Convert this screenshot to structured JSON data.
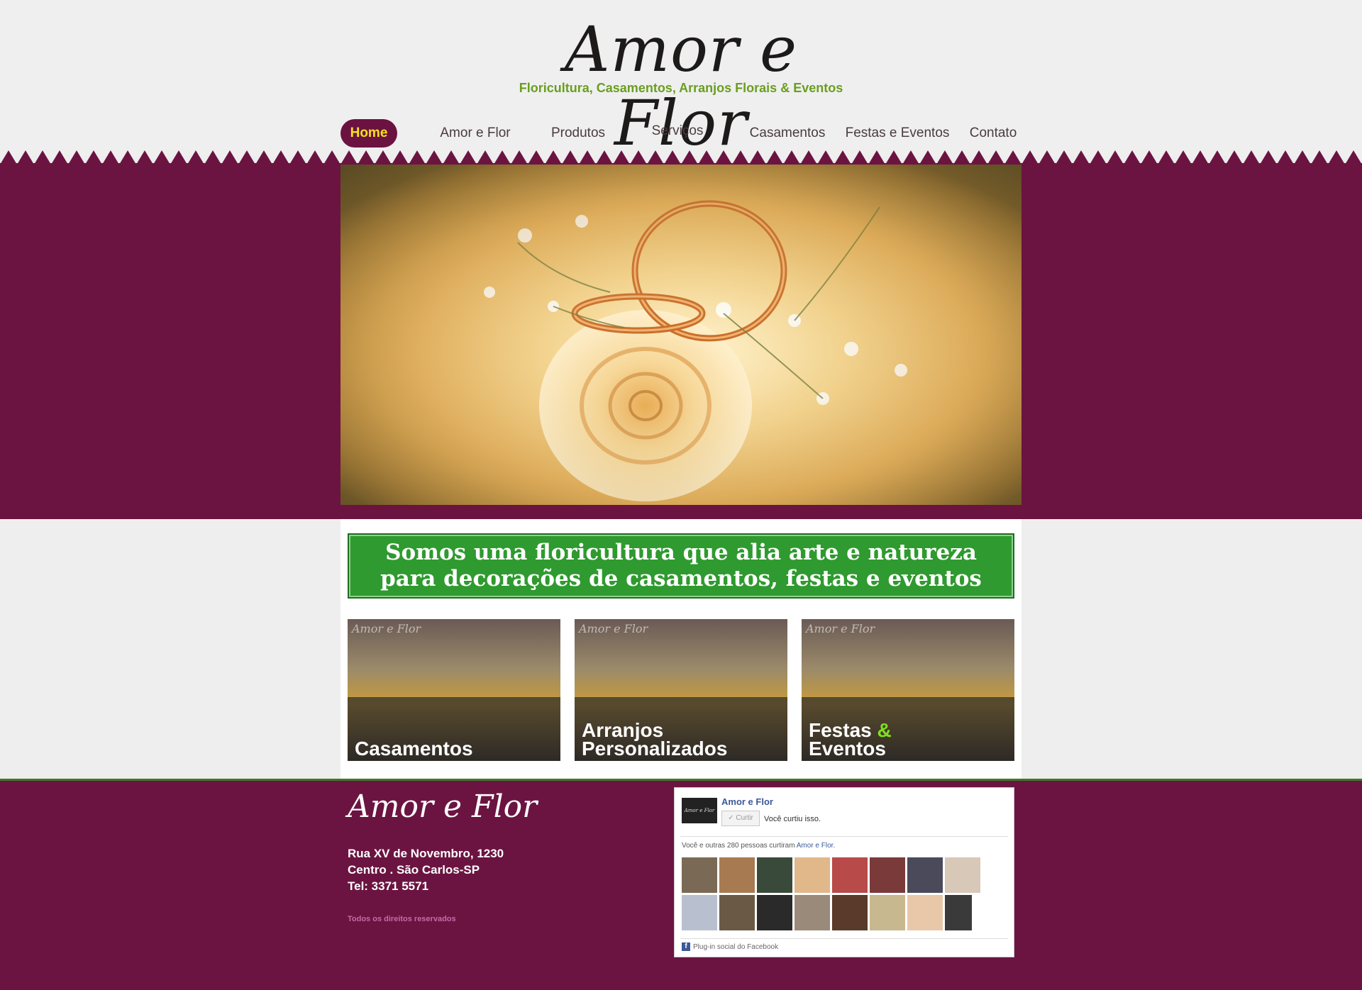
{
  "header": {
    "logo": "Amor e Flor",
    "tagline": "Floricultura, Casamentos, Arranjos Florais & Eventos"
  },
  "nav": [
    {
      "label": "Home",
      "active": true
    },
    {
      "label": "Amor e Flor"
    },
    {
      "label": "Produtos"
    },
    {
      "label": "Serviços"
    },
    {
      "label": "Casamentos"
    },
    {
      "label": "Festas e Eventos"
    },
    {
      "label": "Contato"
    }
  ],
  "banner": {
    "line1": "Somos uma floricultura que alia arte e natureza",
    "line2": "para decorações de casamentos, festas e eventos"
  },
  "cards": [
    {
      "line1": "Casamentos",
      "line2": ""
    },
    {
      "line1": "Arranjos",
      "line2": "Personalizados"
    },
    {
      "line1": "Festas",
      "amp": "&",
      "line2": "Eventos"
    }
  ],
  "card_watermark": "Amor e Flor",
  "footer": {
    "logo": "Amor e Flor",
    "address_line1": "Rua XV de Novembro, 1230",
    "address_line2": "Centro . São Carlos-SP",
    "phone": "Tel: 3371 5571",
    "rights": "Todos os direitos reservados"
  },
  "facebook": {
    "thumb_text": "Amor e Flor",
    "page_name": "Amor e Flor",
    "like_button": "✓ Curtir",
    "liked_text": "Você curtiu isso.",
    "count_text": "Você e outras 280 pessoas curtiram ",
    "count_link": "Amor e Flor.",
    "plugin_text": "Plug-in social do Facebook",
    "fb_icon": "f"
  },
  "colors": {
    "brand": "#6b1441",
    "accent": "#2f9a2f",
    "nav_active_text": "#f2e21c",
    "tagline": "#6a9e1f"
  }
}
